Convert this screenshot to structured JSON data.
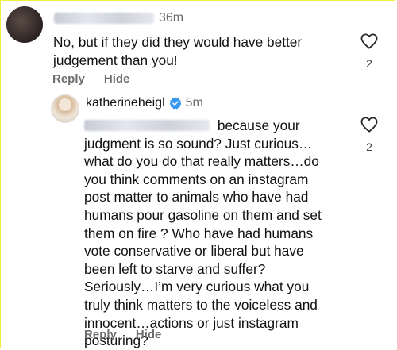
{
  "comments": [
    {
      "time": "36m",
      "lines": [
        "No, but if they did they would have better",
        "judgement than you!"
      ],
      "likes": "2",
      "reply_label": "Reply",
      "hide_label": "Hide"
    },
    {
      "username": "katherineheigl",
      "verified": true,
      "time": "5m",
      "first_line_after_mention": "because your",
      "lines": [
        "judgment is so sound? Just curious…",
        "what do you do that really matters…do",
        "you think comments on an instagram",
        "post matter to animals who have had",
        "humans pour gasoline on them and set",
        "them on fire ? Who have had humans",
        "vote conservative or liberal but have",
        "been left to starve and suffer?",
        "Seriously…I’m very curious what you",
        "truly think matters to the voiceless and",
        "innocent…actions or just instagram",
        "posturing?"
      ],
      "likes": "2",
      "reply_label": "Reply",
      "hide_label": "Hide"
    }
  ],
  "colors": {
    "verified": "#3897f0",
    "border": "#f2ef3a",
    "secondary_text": "#6e6e6e"
  },
  "icons": {
    "like": "heart-outline-icon",
    "verified": "verified-badge-icon"
  }
}
